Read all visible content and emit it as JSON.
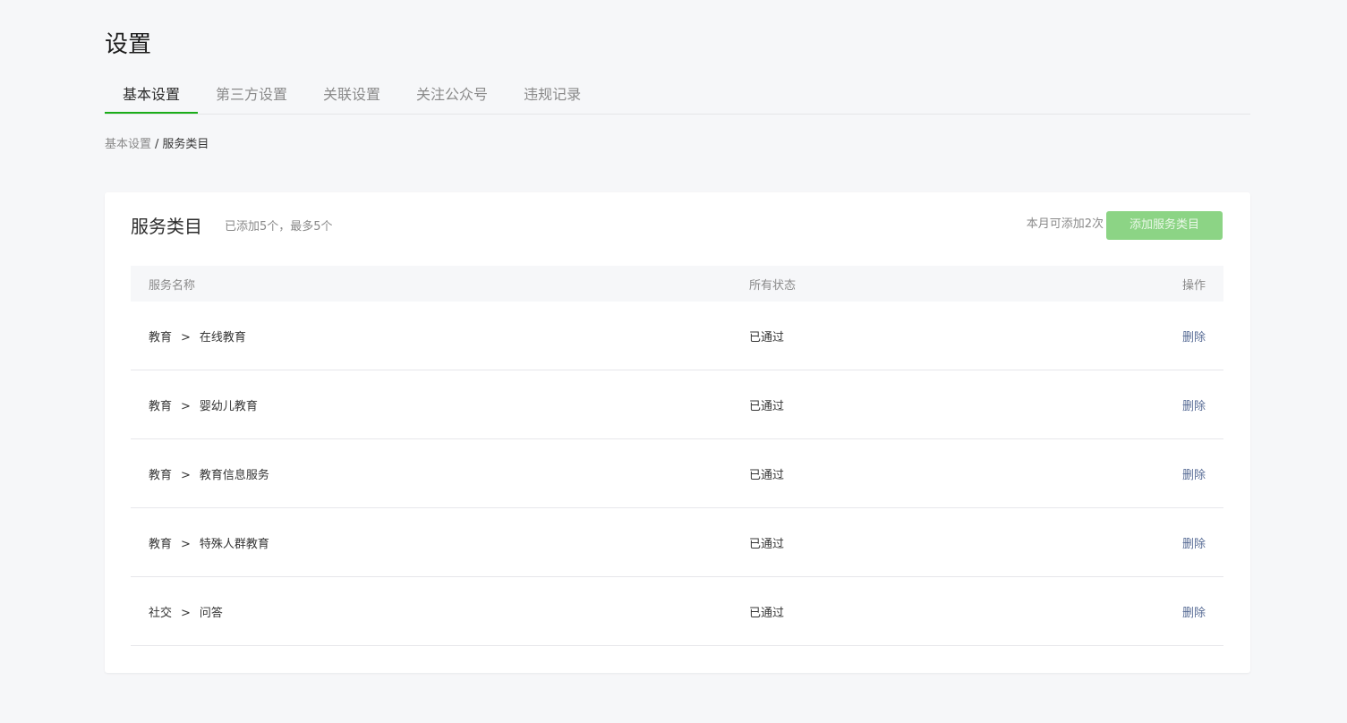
{
  "page": {
    "title": "设置"
  },
  "tabs": [
    {
      "label": "基本设置",
      "active": true
    },
    {
      "label": "第三方设置",
      "active": false
    },
    {
      "label": "关联设置",
      "active": false
    },
    {
      "label": "关注公众号",
      "active": false
    },
    {
      "label": "违规记录",
      "active": false
    }
  ],
  "breadcrumb": {
    "parent": "基本设置",
    "separator": "/",
    "current": "服务类目"
  },
  "card": {
    "title": "服务类目",
    "subtitle": "已添加5个，最多5个",
    "quota": "本月可添加2次",
    "add_button": "添加服务类目"
  },
  "table": {
    "headers": {
      "name": "服务名称",
      "status": "所有状态",
      "action": "操作"
    },
    "separator": ">",
    "rows": [
      {
        "primary": "教育",
        "secondary": "在线教育",
        "status": "已通过",
        "action": "删除"
      },
      {
        "primary": "教育",
        "secondary": "婴幼儿教育",
        "status": "已通过",
        "action": "删除"
      },
      {
        "primary": "教育",
        "secondary": "教育信息服务",
        "status": "已通过",
        "action": "删除"
      },
      {
        "primary": "教育",
        "secondary": "特殊人群教育",
        "status": "已通过",
        "action": "删除"
      },
      {
        "primary": "社交",
        "secondary": "问答",
        "status": "已通过",
        "action": "删除"
      }
    ]
  },
  "colors": {
    "accent": "#1aad19",
    "button_disabled": "#8cd485",
    "link": "#576b95",
    "page_background": "#f6f7f9"
  }
}
